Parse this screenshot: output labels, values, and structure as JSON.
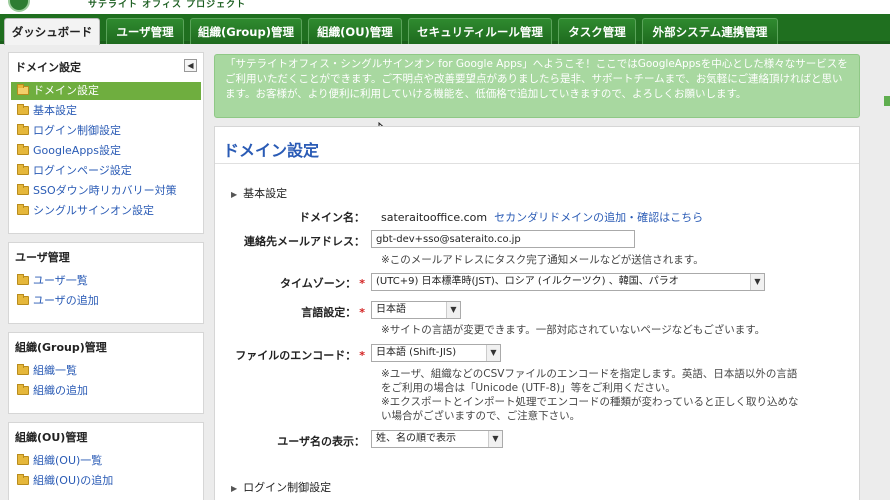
{
  "header": {
    "logo_text": "サテライト オフィス プロジェクト"
  },
  "tabs": [
    {
      "label": "ダッシュボード",
      "active": true
    },
    {
      "label": "ユーザ管理"
    },
    {
      "label": "組織(Group)管理"
    },
    {
      "label": "組織(OU)管理"
    },
    {
      "label": "セキュリティルール管理"
    },
    {
      "label": "タスク管理"
    },
    {
      "label": "外部システム連携管理"
    }
  ],
  "sidebar": {
    "domain": {
      "title": "ドメイン設定",
      "collapse_icon": "◀",
      "items": [
        "ドメイン設定",
        "基本設定",
        "ログイン制御設定",
        "GoogleApps設定",
        "ログインページ設定",
        "SSOダウン時リカバリー対策",
        "シングルサインオン設定"
      ]
    },
    "user": {
      "title": "ユーザ管理",
      "items": [
        "ユーザ一覧",
        "ユーザの追加"
      ]
    },
    "group": {
      "title": "組織(Group)管理",
      "items": [
        "組織一覧",
        "組織の追加"
      ]
    },
    "ou": {
      "title": "組織(OU)管理",
      "items": [
        "組織(OU)一覧",
        "組織(OU)の追加"
      ]
    }
  },
  "notice": {
    "text": "「サテライトオフィス・シングルサインオン for Google Apps」へようこそ！ここではGoogleAppsを中心とした様々なサービスをご利用いただくことができます。ご不明点や改善要望点がありましたら是非、サポートチームまで、お気軽にご連絡頂ければと思います。お客様が、より便利に利用していける機能を、低価格で追加していきますので、よろしくお願いします。"
  },
  "main": {
    "title": "ドメイン設定",
    "section_basic": "基本設定",
    "section_login": "ログイン制御設定",
    "domain_label": "ドメイン名：",
    "domain_value": "sateraitooffice.com",
    "domain_link": "セカンダリドメインの追加・確認はこちら",
    "email_label": "連絡先メールアドレス：",
    "email_value": "gbt-dev+sso@sateraito.co.jp",
    "email_hint": "※このメールアドレスにタスク完了通知メールなどが送信されます。",
    "tz_label": "タイムゾーン：",
    "tz_value": "(UTC+9) 日本標準時(JST)、ロシア (イルクーツク) 、韓国、パラオ",
    "lang_label": "言語設定：",
    "lang_value": "日本語",
    "lang_hint": "※サイトの言語が変更できます。一部対応されていないページなどもございます。",
    "enc_label": "ファイルのエンコード：",
    "enc_value": "日本語 (Shift-JIS)",
    "enc_hint_1": "※ユーザ、組織などのCSVファイルのエンコードを指定します。英語、日本語以外の言語",
    "enc_hint_2": "をご利用の場合は「Unicode (UTF-8)」等をご利用ください。",
    "enc_hint_3": "※エクスポートとインポート処理でエンコードの種類が変わっていると正しく取り込めな",
    "enc_hint_4": "い場合がございますので、ご注意下さい。",
    "name_label": "ユーザ名の表示：",
    "name_value": "姓、名の順で表示",
    "required_mark": "*"
  },
  "colors": {
    "nav": "#1f6f1f",
    "active_item": "#6fae3f",
    "link": "#2a5bb5",
    "notice": "#a8d8a0"
  }
}
